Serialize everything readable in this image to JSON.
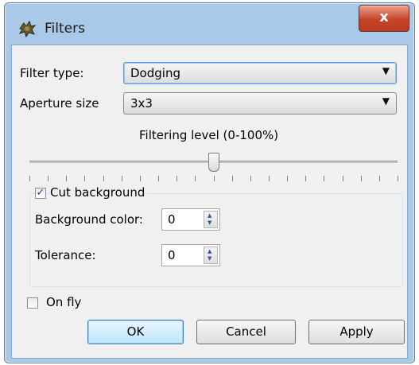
{
  "window": {
    "title": "Filters",
    "close_label": "x"
  },
  "filter_type": {
    "label": "Filter type:",
    "value": "Dodging"
  },
  "aperture": {
    "label": "Aperture size",
    "value": "3x3"
  },
  "filtering": {
    "label": "Filtering level (0-100%)",
    "value_percent": 50
  },
  "cut_background": {
    "label": "Cut background",
    "checked": true,
    "background_color": {
      "label": "Background color:",
      "value": "0"
    },
    "tolerance": {
      "label": "Tolerance:",
      "value": "0"
    }
  },
  "on_fly": {
    "label": "On fly",
    "checked": false
  },
  "buttons": {
    "ok": "OK",
    "cancel": "Cancel",
    "apply": "Apply"
  }
}
